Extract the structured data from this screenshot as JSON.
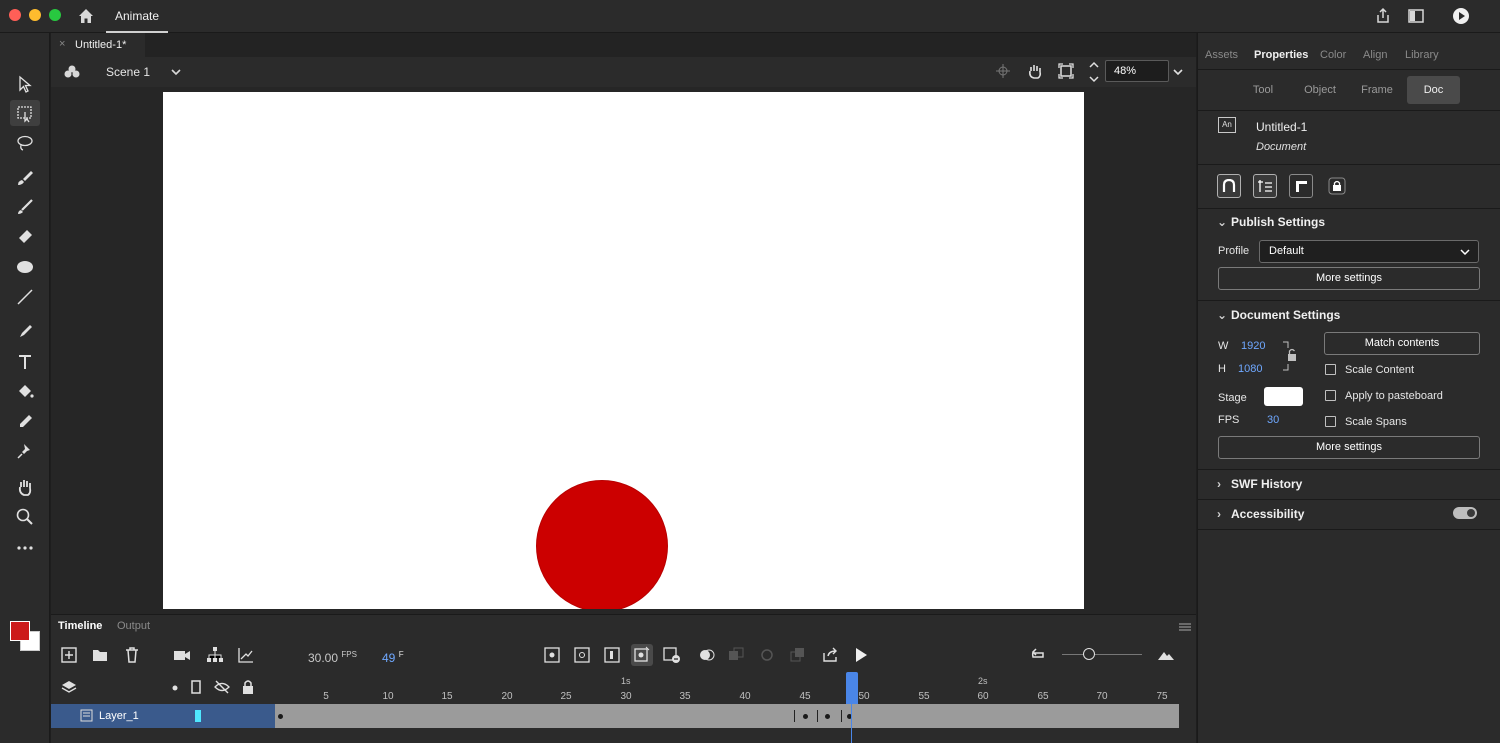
{
  "app": {
    "tab": "Animate",
    "colors": {
      "close": "#ff5f57",
      "minimize": "#febc2e",
      "zoom": "#28c840"
    }
  },
  "document": {
    "tab_title": "Untitled-1*",
    "close_glyph": "×"
  },
  "scenebar": {
    "scene": "Scene 1",
    "zoom": "48%"
  },
  "stage": {
    "background": "#ffffff",
    "ball_color": "#cc0000"
  },
  "right_panel": {
    "tabs": [
      "Assets",
      "Properties",
      "Color",
      "Align",
      "Library"
    ],
    "active_tab": "Properties",
    "subtabs": [
      "Tool",
      "Object",
      "Frame",
      "Doc"
    ],
    "active_subtab": "Doc",
    "doc_icon": "An",
    "doc_name": "Untitled-1",
    "doc_type": "Document",
    "publish": {
      "title": "Publish Settings",
      "profile_label": "Profile",
      "profile_value": "Default",
      "more_settings": "More settings"
    },
    "doc_settings": {
      "title": "Document Settings",
      "w_label": "W",
      "w_value": "1920",
      "h_label": "H",
      "h_value": "1080",
      "match_contents": "Match contents",
      "scale_content": "Scale Content",
      "stage_label": "Stage",
      "apply_pasteboard": "Apply to pasteboard",
      "fps_label": "FPS",
      "fps_value": "30",
      "scale_spans": "Scale Spans",
      "more_settings": "More settings"
    },
    "swf_history": "SWF History",
    "accessibility": "Accessibility"
  },
  "timeline": {
    "tabs": [
      "Timeline",
      "Output"
    ],
    "fps": "30.00",
    "fps_unit": "FPS",
    "frame": "49",
    "frame_unit": "F",
    "ruler_numbers": [
      "5",
      "10",
      "15",
      "20",
      "25",
      "30",
      "35",
      "40",
      "45",
      "50",
      "55",
      "60",
      "65",
      "70",
      "75"
    ],
    "ruler_seconds": [
      "1s",
      "2s"
    ],
    "layer": "Layer_1",
    "current_frame": 49
  },
  "colors": {
    "stroke": "#cc1a1a",
    "fill": "#ffffff",
    "accent": "#4a86e8",
    "layer_selected": "#3a5a8c"
  }
}
